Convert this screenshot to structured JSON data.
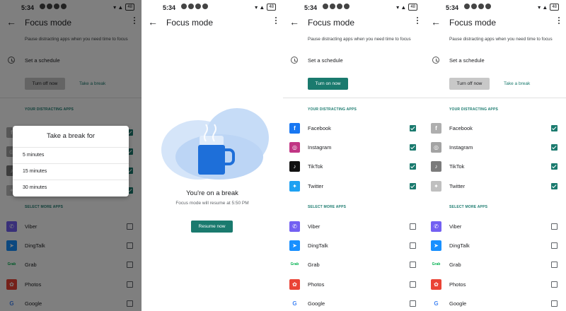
{
  "status": {
    "time": "5:34",
    "battery": "48"
  },
  "appbar": {
    "title": "Focus mode"
  },
  "focus": {
    "description": "Pause distracting apps when you need time to focus",
    "schedule_label": "Set a schedule",
    "turn_on_label": "Turn on now",
    "turn_off_label": "Turn off now",
    "take_break_label": "Take a break",
    "section_distracting": "YOUR DISTRACTING APPS",
    "section_select_more": "SELECT MORE APPS"
  },
  "distracting_apps": [
    {
      "name": "Facebook",
      "icon": "facebook-icon",
      "color": "#1877f2",
      "glyph": "f",
      "checked": true
    },
    {
      "name": "Instagram",
      "icon": "instagram-icon",
      "color": "#c13584",
      "glyph": "◎",
      "checked": true
    },
    {
      "name": "TikTok",
      "icon": "tiktok-icon",
      "color": "#111111",
      "glyph": "♪",
      "checked": true
    },
    {
      "name": "Twitter",
      "icon": "twitter-icon",
      "color": "#1da1f2",
      "glyph": "✦",
      "checked": true
    }
  ],
  "more_apps": [
    {
      "name": "Viber",
      "icon": "viber-icon",
      "color": "#7360f2",
      "glyph": "✆",
      "checked": false
    },
    {
      "name": "DingTalk",
      "icon": "dingtalk-icon",
      "color": "#1890ff",
      "glyph": "➤",
      "checked": false
    },
    {
      "name": "Grab",
      "icon": "grab-icon",
      "color": "#00b14f",
      "glyph": "Grab",
      "checked": false
    },
    {
      "name": "Photos",
      "icon": "photos-icon",
      "color": "#ea4335",
      "glyph": "✿",
      "checked": false
    },
    {
      "name": "Google",
      "icon": "google-icon",
      "color": "#4285f4",
      "glyph": "G",
      "checked": false
    }
  ],
  "break_dialog": {
    "title": "Take a break for",
    "options": [
      "5 minutes",
      "15 minutes",
      "30 minutes"
    ]
  },
  "break_screen": {
    "title": "You're on a break",
    "subtitle": "Focus mode will resume at 5:50 PM",
    "resume_label": "Resume now"
  },
  "colors": {
    "accent": "#1a7a6e",
    "illustration_cloud": "#c6dcf7",
    "cup": "#1e6fd9"
  }
}
